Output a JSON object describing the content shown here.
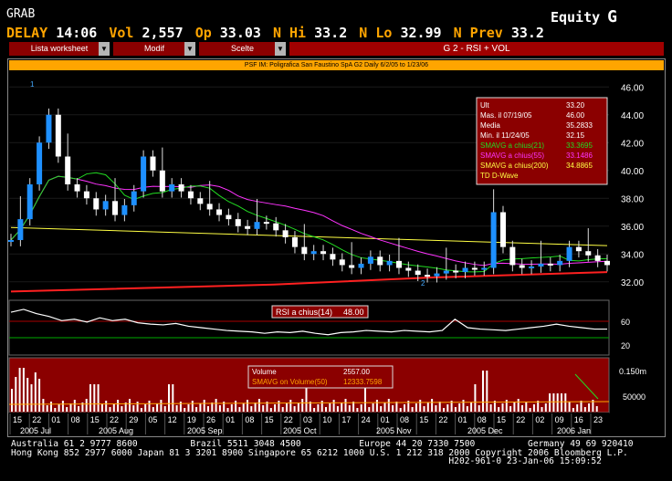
{
  "header": {
    "ticker_short": "GRAB",
    "market": "Equity",
    "market_key": "G"
  },
  "quote": [
    {
      "k": "DELAY",
      "v": "14:06"
    },
    {
      "k": "Vol",
      "v": "2,557"
    },
    {
      "k": "Op",
      "v": "33.03"
    },
    {
      "k": "N Hi",
      "v": "33.2"
    },
    {
      "k": "N Lo",
      "v": "32.99"
    },
    {
      "k": "N Prev",
      "v": "33.2"
    }
  ],
  "menu": {
    "worksheet": "Lista worksheet",
    "modif": "Modif",
    "scelte": "Scelte",
    "title": "G  2 - RSI + VOL"
  },
  "chart_title": "PSF IM: Poligrafica San Faustino SpA G2 Daily 6/2/05 to 1/23/06",
  "stats_box": {
    "rows": [
      {
        "label": "Ult",
        "value": "33.20",
        "color": "#ffffff"
      },
      {
        "label": "Mas. il  07/19/05",
        "value": "46.00",
        "color": "#ffffff"
      },
      {
        "label": "Media",
        "value": "35.2833",
        "color": "#ffffff"
      },
      {
        "label": "Min. il  11/24/05",
        "value": "32.15",
        "color": "#ffffff"
      },
      {
        "label": "SMAVG a chius(21)",
        "value": "33.3695",
        "color": "#22dd22"
      },
      {
        "label": "SMAVG a chius(55)",
        "value": "33.1486",
        "color": "#ff33ff"
      },
      {
        "label": "SMAVG a chius(200)",
        "value": "34.8865",
        "color": "#ffff44"
      },
      {
        "label": "TD D-Wave",
        "value": "",
        "color": "#ffff44"
      }
    ]
  },
  "price_axis": [
    "46.00",
    "44.00",
    "42.00",
    "40.00",
    "38.00",
    "36.00",
    "34.00",
    "32.00"
  ],
  "wave_labels": [
    "1",
    "2"
  ],
  "rsi": {
    "legend_label": "RSI a chius(14)",
    "legend_value": "48.00",
    "axis": [
      "60",
      "20"
    ]
  },
  "volume": {
    "legend_rows": [
      {
        "label": "Volume",
        "value": "2557.00"
      },
      {
        "label": "SMAVG on Volume(50)",
        "value": "12333.7598"
      }
    ],
    "axis": [
      "0.150m",
      "50000"
    ]
  },
  "x_days": [
    "15",
    "22",
    "01",
    "08",
    "15",
    "22",
    "29",
    "05",
    "12",
    "19",
    "26",
    "01",
    "08",
    "15",
    "22",
    "03",
    "10",
    "17",
    "24",
    "01",
    "08",
    "15",
    "22",
    "01",
    "08",
    "15",
    "22",
    "02",
    "09",
    "16",
    "23"
  ],
  "x_months": [
    "2005 Jul",
    "2005 Aug",
    "2005 Sep",
    "2005 Oct",
    "2005 Nov",
    "2005 Dec",
    "2006 Jan"
  ],
  "footer": {
    "line1": "Australia 61 2 9777 8600          Brazil 5511 3048 4500           Europe 44 20 7330 7500          Germany 49 69 920410",
    "line2": "Hong Kong 852 2977 6000 Japan 81 3 3201 8900 Singapore 65 6212 1000 U.S. 1 212 318 2000 Copyright 2006 Bloomberg L.P.",
    "line3": "                                                                                   H202-961-0 23-Jan-06 15:09:52"
  },
  "chart_data": {
    "type": "line",
    "ylim": [
      31,
      47
    ],
    "sma200_start": 35.9,
    "sma200_end": 34.6,
    "price_path": [
      35.0,
      36.5,
      39,
      42,
      44,
      41,
      39,
      38.5,
      38,
      37.2,
      37.8,
      36.8,
      37.5,
      38.5,
      41,
      40,
      38.5,
      39,
      38.5,
      38,
      37.6,
      37.2,
      36.8,
      36.5,
      36.0,
      35.8,
      36.3,
      36.2,
      35.7,
      35.2,
      34.5,
      34.0,
      34.2,
      34.0,
      33.6,
      33.2,
      33.0,
      33.3,
      33.8,
      33.2,
      33.5,
      33.0,
      32.8,
      32.5,
      32.4,
      32.6,
      32.8,
      32.7,
      33.0,
      32.9,
      33.0,
      37,
      34.5,
      33.2,
      33.0,
      33.1,
      33.3,
      33.2,
      33.5,
      34.5,
      34.2,
      33.9,
      33.5,
      33.2
    ],
    "rsi_path": [
      72,
      76,
      70,
      66,
      60,
      62,
      58,
      64,
      60,
      62,
      57,
      55,
      54,
      56,
      52,
      50,
      48,
      46,
      45,
      44,
      42,
      44,
      43,
      45,
      42,
      40,
      43,
      44,
      46,
      45,
      44,
      46,
      45,
      44,
      46,
      62,
      50,
      48,
      47,
      46,
      48,
      50,
      52,
      55,
      52,
      50,
      48,
      48
    ]
  }
}
